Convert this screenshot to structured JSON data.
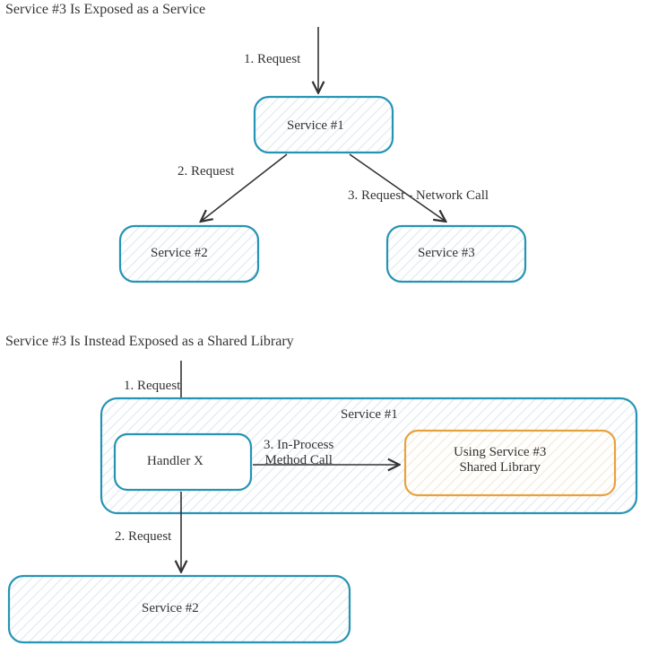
{
  "section1": {
    "title": "Service #3 Is Exposed as a Service",
    "req1": "1. Request",
    "req2": "2. Request",
    "req3": "3. Request - Network Call",
    "box1": "Service #1",
    "box2": "Service #2",
    "box3": "Service #3"
  },
  "section2": {
    "title": "Service #3 Is Instead Exposed as a Shared Library",
    "req1": "1. Request",
    "call3": "3. In-Process\nMethod Call",
    "req2": "2. Request",
    "outer": "Service #1",
    "handler": "Handler X",
    "lib": "Using Service #3\nShared Library",
    "box2": "Service #2"
  },
  "colors": {
    "primary": "#2694b4",
    "hatch": "#f0f7fa",
    "orange": "#e8a23d",
    "orangeHatch": "#fdf6ec",
    "ink": "#333333"
  }
}
